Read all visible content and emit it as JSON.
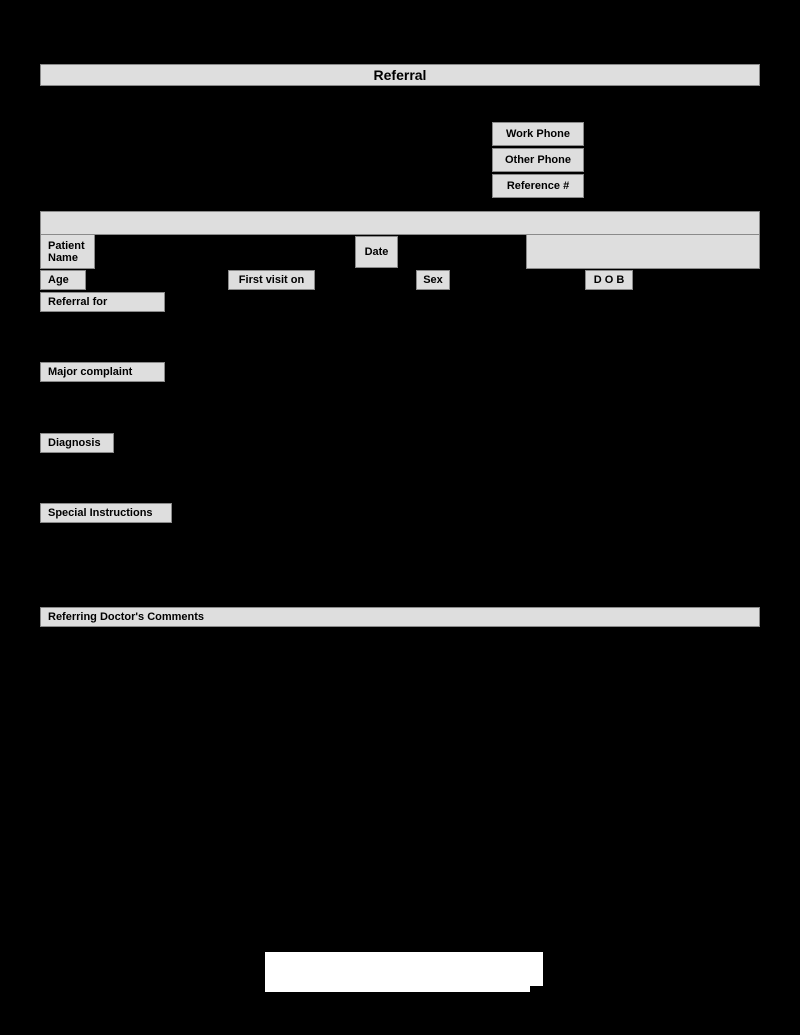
{
  "document": {
    "title": "Referral",
    "page_background": "#000000",
    "field_fill": "#dedede",
    "field_border": "#8a8a8a",
    "footer_fill": "#ffffff"
  },
  "contact": {
    "work_phone_label": "Work Phone",
    "other_phone_label": "Other Phone",
    "reference_number_label": "Reference #",
    "work_phone_value": "",
    "other_phone_value": "",
    "reference_number_value": ""
  },
  "patient": {
    "header_band_value": "",
    "name_label": "Patient\nName",
    "name_value": "",
    "date_label": "Date",
    "date_value": "",
    "age_label": "Age",
    "age_value": "",
    "first_visit_label": "First visit on",
    "first_visit_value": "",
    "sex_label": "Sex",
    "sex_value": "",
    "dob_label": "D O B",
    "dob_value": "",
    "referral_for_label": "Referral for",
    "referral_for_value": ""
  },
  "sections": {
    "major_complaint_label": "Major complaint",
    "major_complaint_value": "",
    "diagnosis_label": "Diagnosis",
    "diagnosis_value": "",
    "special_instructions_label": "Special Instructions",
    "special_instructions_value": "",
    "referring_comments_label": "Referring Doctor's Comments",
    "referring_comments_value": ""
  },
  "footer": {
    "plate_value": ""
  }
}
